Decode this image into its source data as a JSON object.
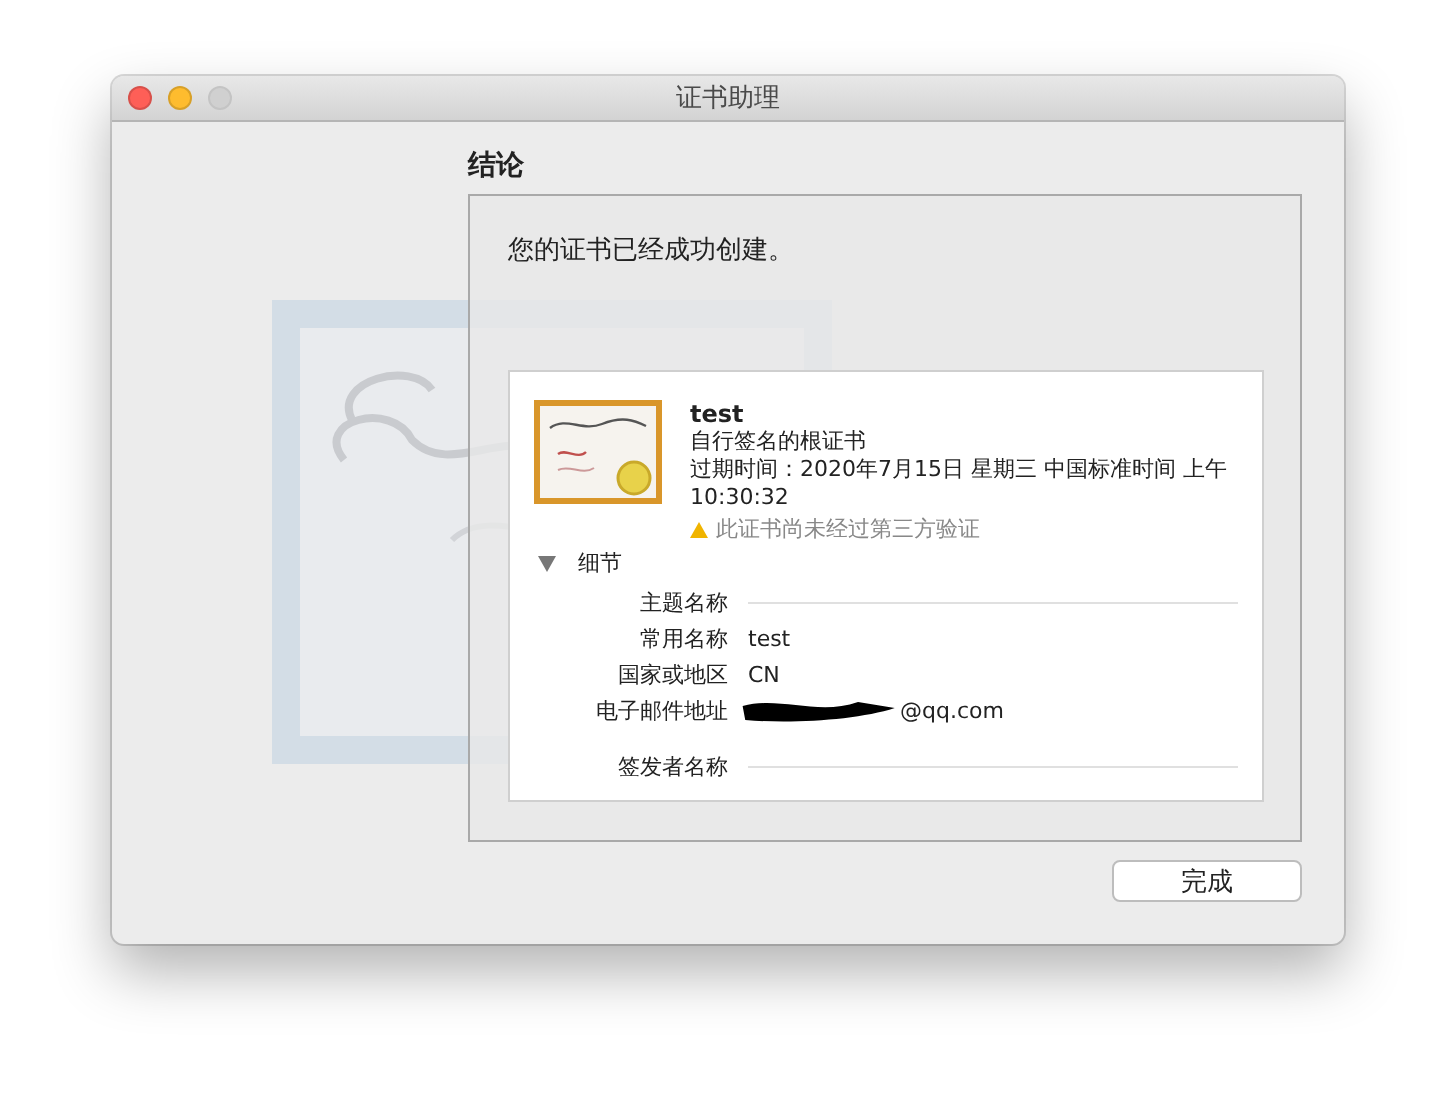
{
  "window": {
    "title": "证书助理",
    "controls": [
      {
        "kind": "close"
      },
      {
        "kind": "minimize"
      },
      {
        "kind": "zoom",
        "disabled": true
      }
    ]
  },
  "heading": "结论",
  "message": "您的证书已经成功创建。",
  "certificate": {
    "name": "test",
    "type": "自行签名的根证书",
    "expiry": "过期时间：2020年7月15日 星期三 中国标准时间 上午 10:30:32",
    "warning": "此证书尚未经过第三方验证"
  },
  "details": {
    "label": "细节",
    "expanded": true,
    "rows": [
      {
        "kind": "section",
        "label": "主题名称"
      },
      {
        "kind": "field",
        "label": "常用名称",
        "value": "test"
      },
      {
        "kind": "field",
        "label": "国家或地区",
        "value": "CN"
      },
      {
        "kind": "redacted",
        "label": "电子邮件地址",
        "value": "@qq.com"
      },
      {
        "kind": "section",
        "label": "签发者名称"
      }
    ]
  },
  "buttons": [
    "完成"
  ]
}
